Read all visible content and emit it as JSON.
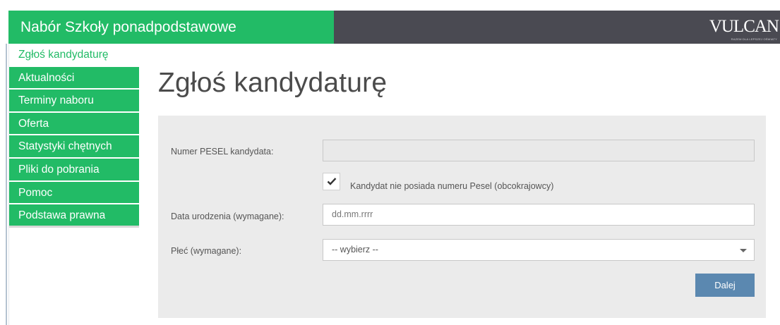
{
  "header": {
    "title": "Nabór Szkoły ponadpodstawowe",
    "logo_text": "VULCAN",
    "logo_subtext": "RAZEM DLA LEPSZEJ OŚWIATY"
  },
  "sidebar": {
    "items": [
      {
        "label": "Zgłoś kandydaturę",
        "active": true
      },
      {
        "label": "Aktualności"
      },
      {
        "label": "Terminy naboru"
      },
      {
        "label": "Oferta"
      },
      {
        "label": "Statystyki chętnych"
      },
      {
        "label": "Pliki do pobrania"
      },
      {
        "label": "Pomoc"
      },
      {
        "label": "Podstawa prawna"
      }
    ]
  },
  "page": {
    "title": "Zgłoś kandydaturę"
  },
  "form": {
    "pesel_label": "Numer PESEL kandydata:",
    "pesel_value": "",
    "no_pesel_label": "Kandydat nie posiada numeru Pesel (obcokrajowcy)",
    "no_pesel_checked": true,
    "birthdate_label": "Data urodzenia (wymagane):",
    "birthdate_placeholder": "dd.mm.rrrr",
    "gender_label": "Płeć (wymagane):",
    "gender_value": "-- wybierz --",
    "submit_label": "Dalej"
  },
  "colors": {
    "brand_green": "#22bb66",
    "header_dark": "#4a4a52",
    "button_blue": "#5b88b0",
    "panel_bg": "#ebebeb"
  },
  "icons": {
    "checkmark": "check-icon",
    "dropdown": "caret-down-icon"
  }
}
